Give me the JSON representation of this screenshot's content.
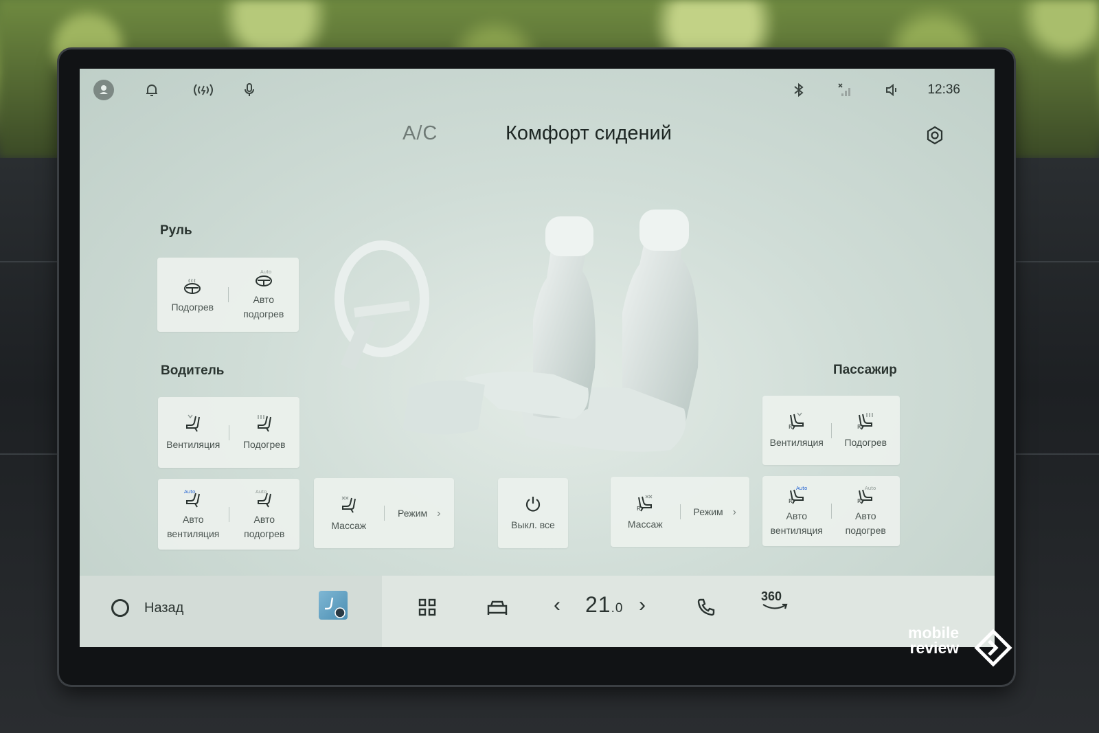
{
  "status_bar": {
    "time": "12:36",
    "icons": [
      "profile-icon",
      "bell-icon",
      "wireless-charging-icon",
      "microphone-icon",
      "bluetooth-icon",
      "no-signal-icon",
      "volume-icon"
    ]
  },
  "header": {
    "tab_ac": "A/C",
    "title": "Комфорт сидений"
  },
  "steering": {
    "label": "Руль",
    "heat": "Подогрев",
    "auto_heat_1": "Авто",
    "auto_heat_2": "подогрев"
  },
  "driver": {
    "label": "Водитель",
    "vent": "Вентиляция",
    "heat": "Подогрев",
    "auto_vent_1": "Авто",
    "auto_vent_2": "вентиляция",
    "auto_heat_1": "Авто",
    "auto_heat_2": "подогрев",
    "massage": "Массаж",
    "mode": "Режим"
  },
  "all_off": "Выкл. все",
  "passenger": {
    "label": "Пассажир",
    "vent": "Вентиляция",
    "heat": "Подогрев",
    "auto_vent_1": "Авто",
    "auto_vent_2": "вентиляция",
    "auto_heat_1": "Авто",
    "auto_heat_2": "подогрев",
    "massage": "Массаж",
    "mode": "Режим"
  },
  "bottom_bar": {
    "back": "Назад",
    "temp_int": "21",
    "temp_dec": ".0",
    "surround_view": "360"
  },
  "watermark": {
    "line1": "mobile",
    "line2": "review"
  },
  "colors": {
    "screen_bg": "#d0ddd7",
    "card_bg": "#ebf0ec",
    "accent_auto": "#1f5fd1"
  }
}
